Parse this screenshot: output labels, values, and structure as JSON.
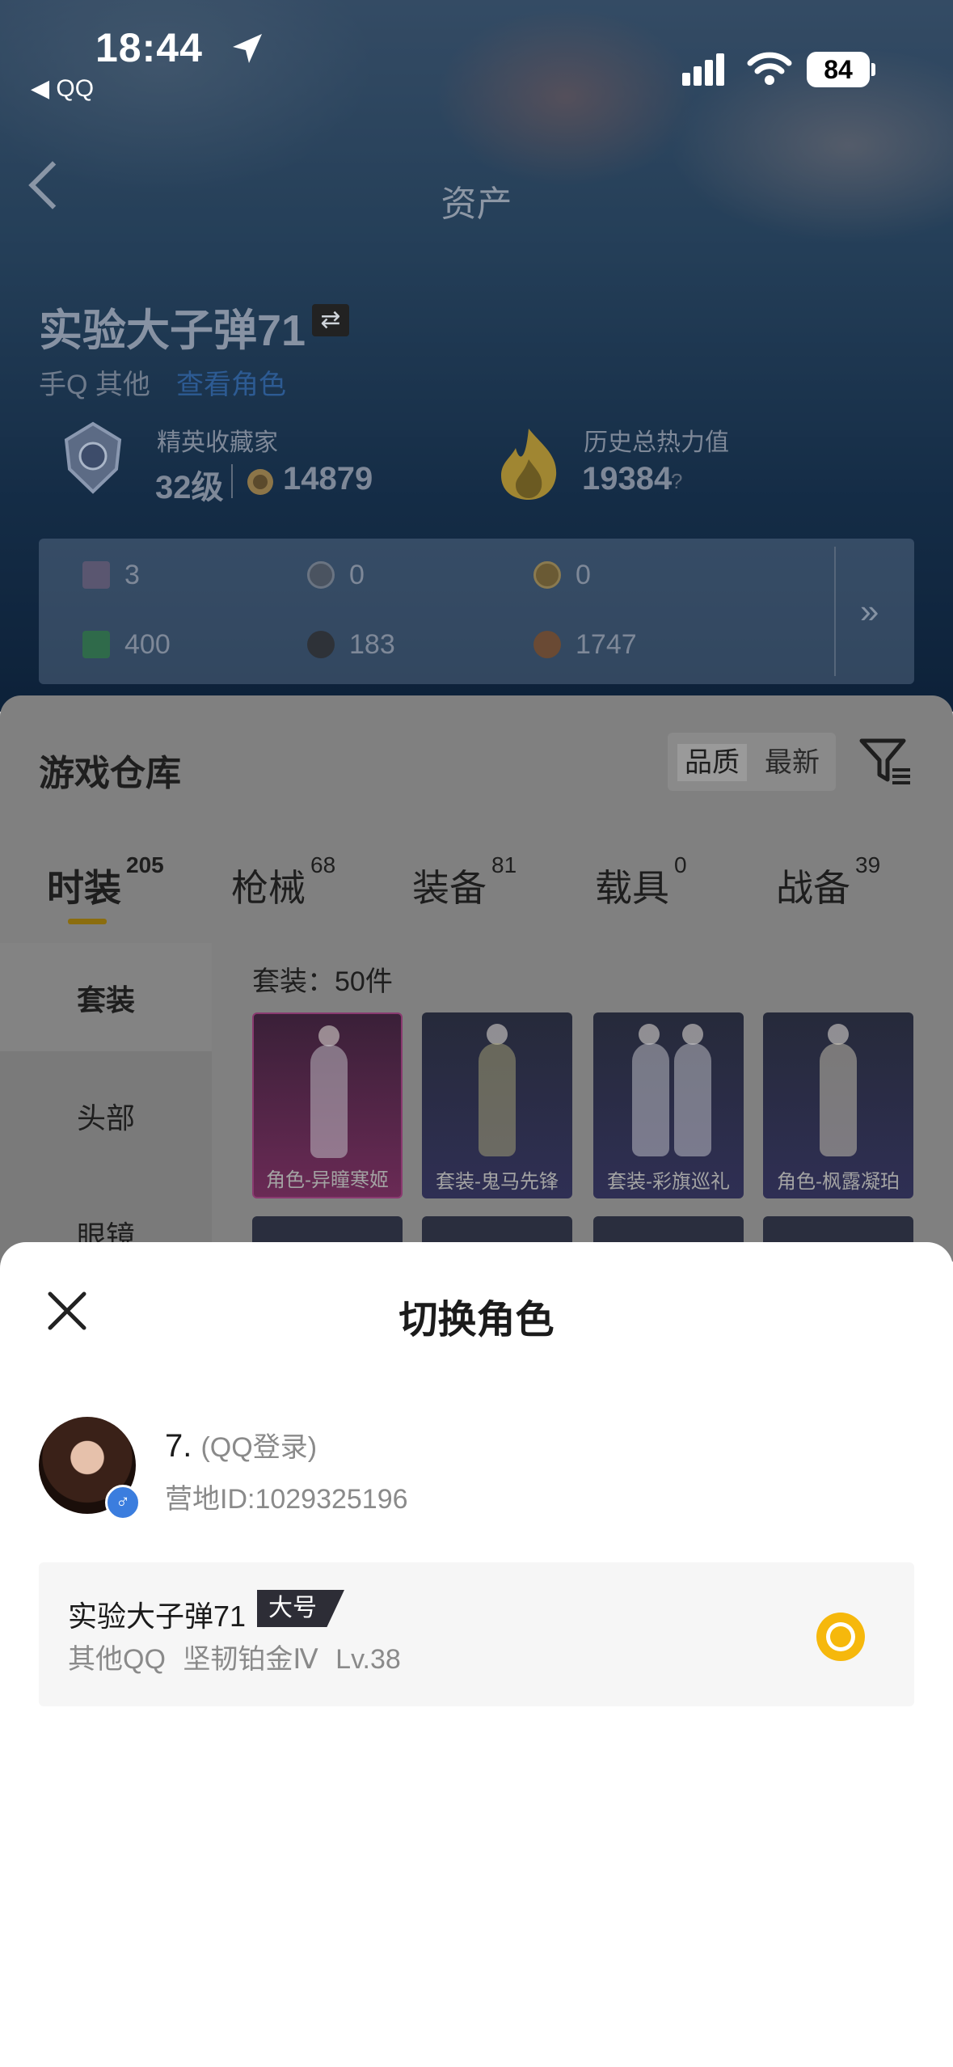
{
  "status_bar": {
    "time": "18:44",
    "back_app": "◀ QQ",
    "battery": "84"
  },
  "header": {
    "title": "资产"
  },
  "role": {
    "name": "实验大子弹71",
    "swap_icon": "⇄",
    "sub": "手Q 其他",
    "sub_link": "查看角色"
  },
  "stats": {
    "collector_label": "精英收藏家",
    "collector_level": "32级",
    "collector_points": "14879",
    "heat_label": "历史总热力值",
    "heat_value": "19384",
    "heat_help": "?"
  },
  "resources": [
    {
      "icon": "card-icon",
      "value": "3"
    },
    {
      "icon": "coin-s-icon",
      "value": "0"
    },
    {
      "icon": "coin-a-icon",
      "value": "0"
    },
    {
      "icon": "cash-icon",
      "value": "400"
    },
    {
      "icon": "orb-icon",
      "value": "183"
    },
    {
      "icon": "bronze-icon",
      "value": "1747"
    }
  ],
  "inventory": {
    "title": "游戏仓库",
    "sort": [
      "品质",
      "最新"
    ],
    "tabs": [
      {
        "label": "时装",
        "count": "205"
      },
      {
        "label": "枪械",
        "count": "68"
      },
      {
        "label": "装备",
        "count": "81"
      },
      {
        "label": "载具",
        "count": "0"
      },
      {
        "label": "战备",
        "count": "39"
      }
    ],
    "side": [
      "套装",
      "头部",
      "眼镜"
    ],
    "count_text": "套装：50件",
    "cards": [
      "角色-异瞳寒姬",
      "套装-鬼马先锋",
      "套装-彩旗巡礼",
      "角色-枫露凝珀"
    ]
  },
  "sheet": {
    "title": "切换角色",
    "account_name": "7.",
    "account_login": "(QQ登录)",
    "account_id": "营地ID:1029325196",
    "gender": "♂",
    "role_name": "实验大子弹71",
    "role_badge": "大号",
    "role_sub": "其他QQ 坚韧铂金Ⅳ Lv.38"
  },
  "colors": {
    "accent": "#f6b80c",
    "badge": "#2d2d36",
    "gender": "#3b7dde"
  }
}
